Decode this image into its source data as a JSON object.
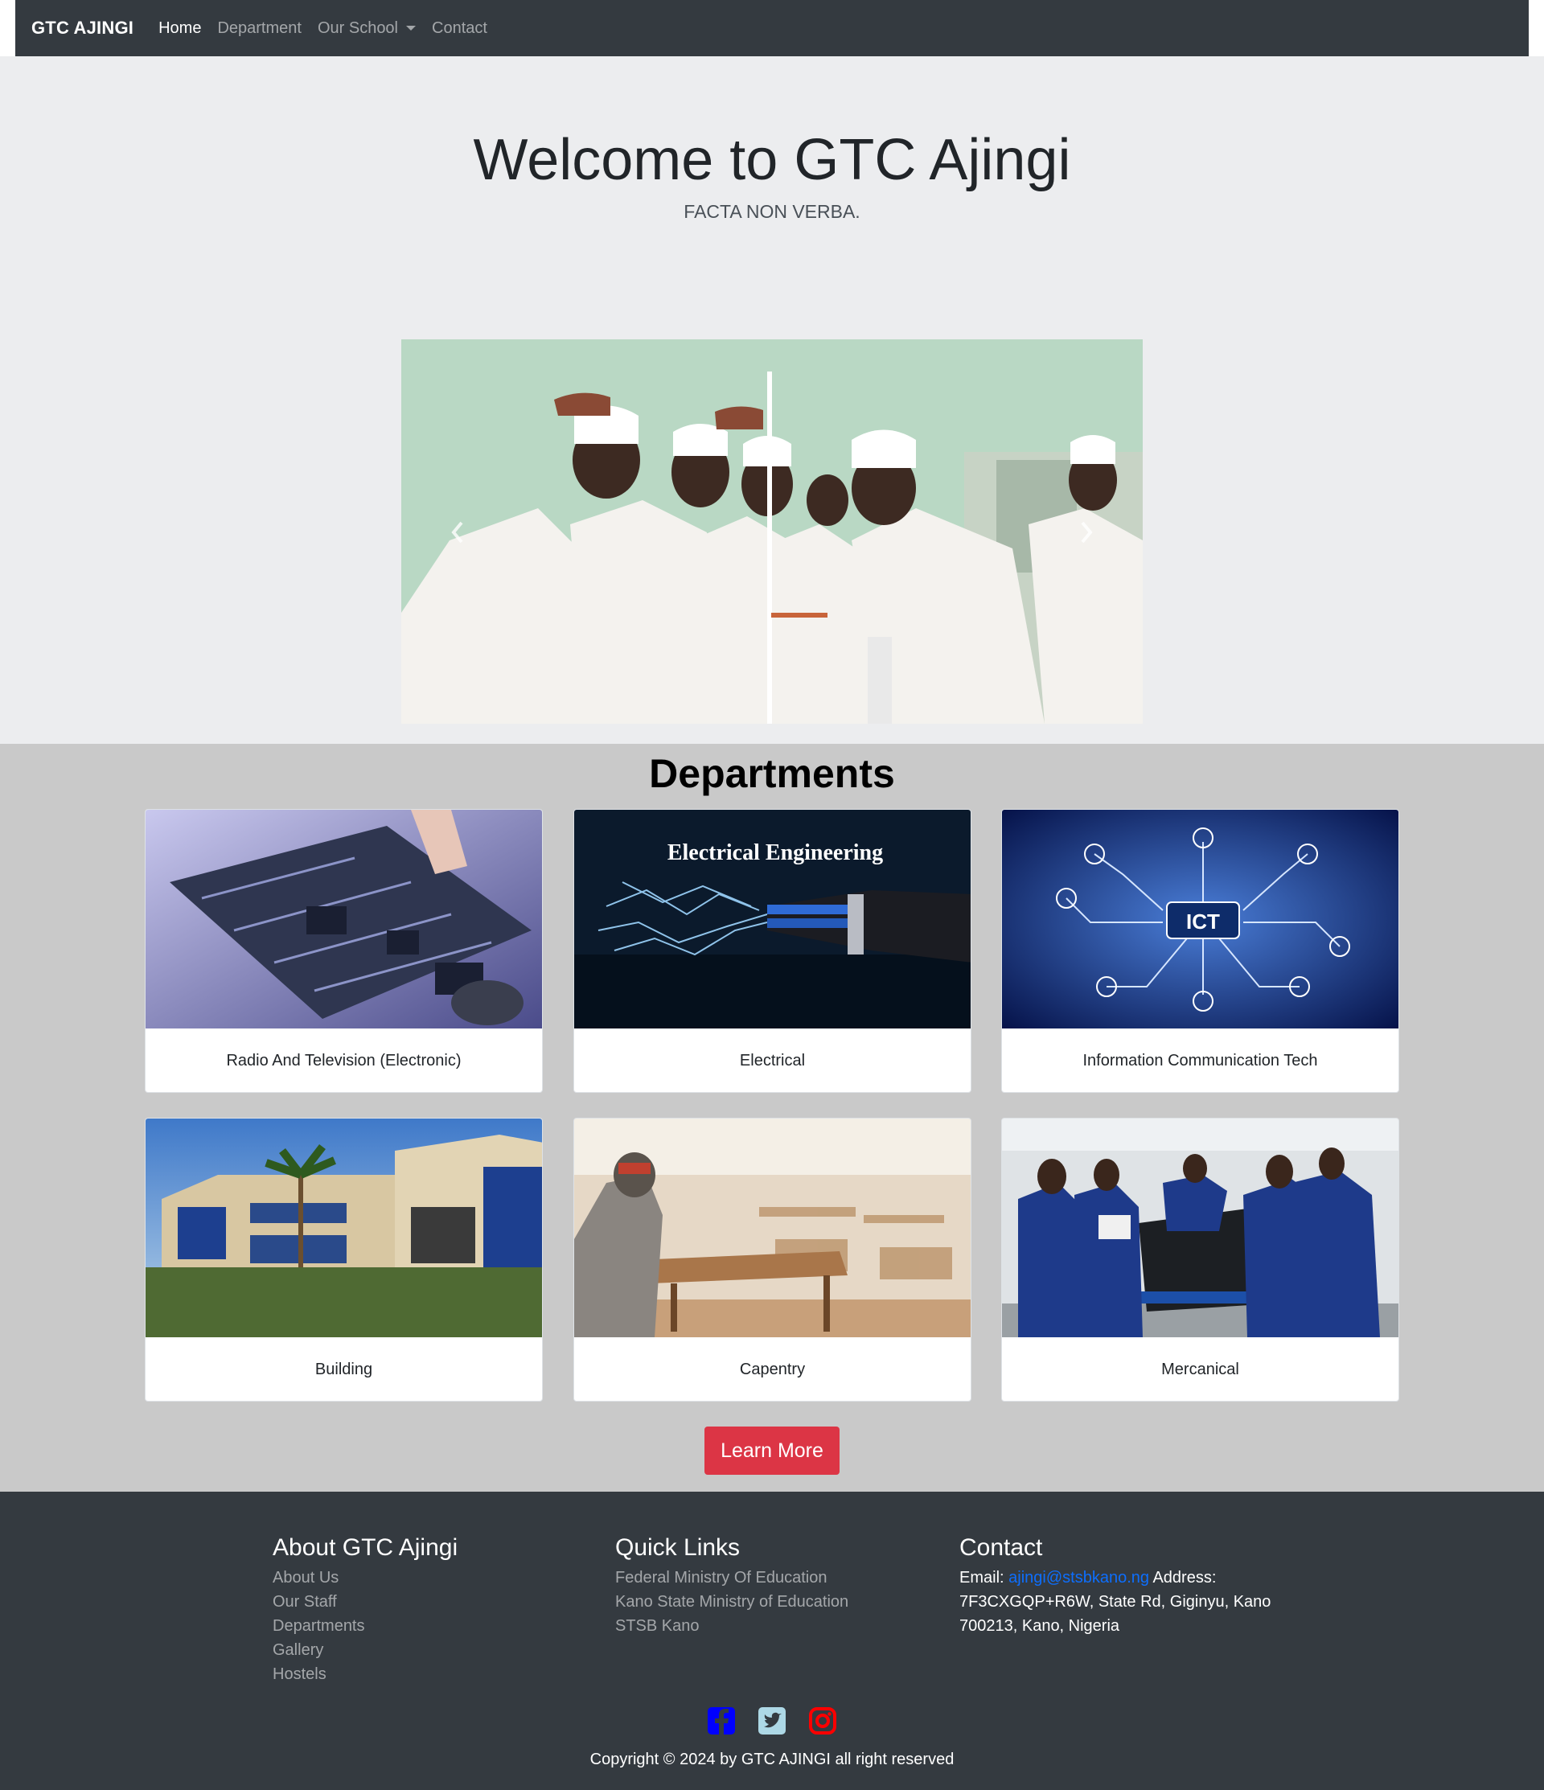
{
  "navbar": {
    "brand": "GTC AJINGI",
    "links": [
      "Home",
      "Department",
      "Our School",
      "Contact"
    ]
  },
  "hero": {
    "title": "Welcome to GTC Ajingi",
    "subtitle": "FACTA NON VERBA."
  },
  "carousel": {
    "prev_icon": "chevron-left-icon",
    "next_icon": "chevron-right-icon"
  },
  "departments": {
    "title": "Departments",
    "cards": [
      {
        "label": "Radio And Television (Electronic)"
      },
      {
        "label": "Electrical",
        "image_caption": "Electrical Engineering"
      },
      {
        "label": "Information Communication Tech",
        "image_caption": "ICT"
      },
      {
        "label": "Building"
      },
      {
        "label": "Capentry"
      },
      {
        "label": "Mercanical"
      }
    ],
    "button": "Learn More"
  },
  "footer": {
    "about": {
      "heading": "About GTC Ajingi",
      "links": [
        "About Us",
        "Our Staff",
        "Departments",
        "Gallery",
        "Hostels"
      ]
    },
    "quick_links": {
      "heading": "Quick Links",
      "links": [
        "Federal Ministry Of Education",
        "Kano State Ministry of Education",
        "STSB Kano"
      ]
    },
    "contact": {
      "heading": "Contact",
      "email_label": "Email:",
      "email": "ajingi@stsbkano.ng",
      "address_label": "Address:",
      "address": "7F3CXGQP+R6W, State Rd, Giginyu, Kano 700213, Kano, Nigeria"
    },
    "social_icons": [
      "facebook-icon",
      "twitter-icon",
      "instagram-icon"
    ],
    "copyright": "Copyright © 2024 by GTC AJINGI all right reserved"
  },
  "colors": {
    "navbar": "#343a40",
    "hero_bg": "#ecedef",
    "departments_bg": "#c9c9c9",
    "button": "#dc3545",
    "link": "#0d6efd",
    "facebook": "#0000ff",
    "twitter": "#add8e6",
    "instagram": "#ff0000"
  }
}
